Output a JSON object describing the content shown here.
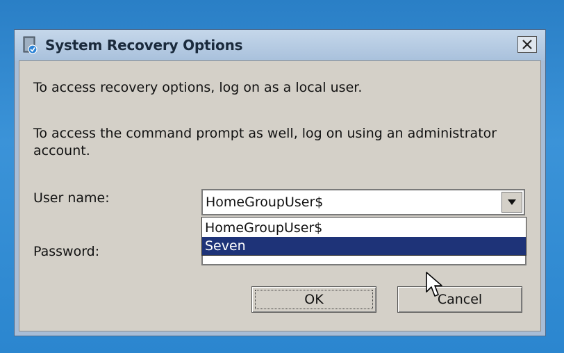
{
  "window": {
    "title": "System Recovery Options",
    "icons": {
      "app": "recovery-disc-icon",
      "close": "close-icon"
    }
  },
  "body": {
    "line1": "To access recovery options, log on as a local user.",
    "line2a": "To access the command prompt as well, log on using an administrator",
    "line2b": "account."
  },
  "form": {
    "username_label": "User name:",
    "username_value": "HomeGroupUser$",
    "username_options": [
      "HomeGroupUser$",
      "Seven"
    ],
    "highlighted_option": "Seven",
    "password_label": "Password:"
  },
  "buttons": {
    "ok": "OK",
    "cancel": "Cancel"
  },
  "colors": {
    "desktop": "#2b86cf",
    "dialog_face": "#d4d0c8",
    "selection": "#1e3378"
  }
}
